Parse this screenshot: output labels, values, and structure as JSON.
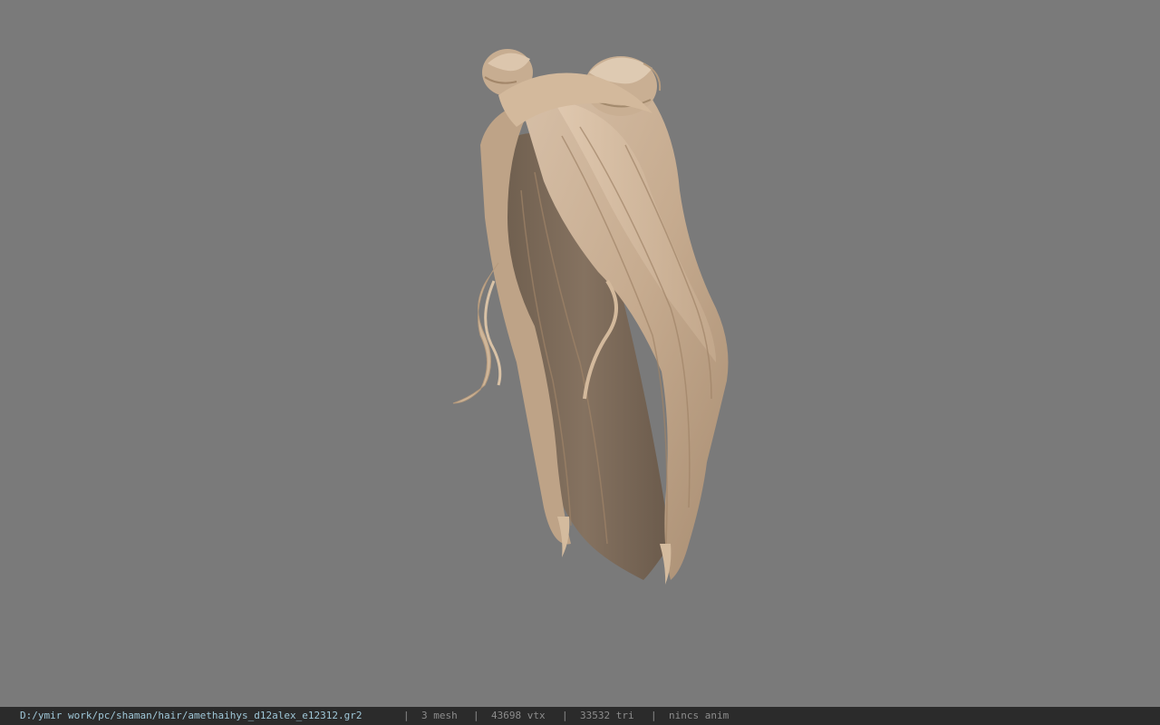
{
  "viewport": {
    "background_color": "#7a7a7a",
    "model_name": "hair-model"
  },
  "statusbar": {
    "background_color": "#2b2b2b",
    "path_color": "#9fc7d8",
    "file_path": "D:/ymir work/pc/shaman/hair/amethaihys_d12alex_e12312.gr2",
    "separator": "|",
    "mesh_count": "3 mesh",
    "vertex_count": "43698 vtx",
    "triangle_count": "33532 tri",
    "anim_status": "nincs anim"
  }
}
